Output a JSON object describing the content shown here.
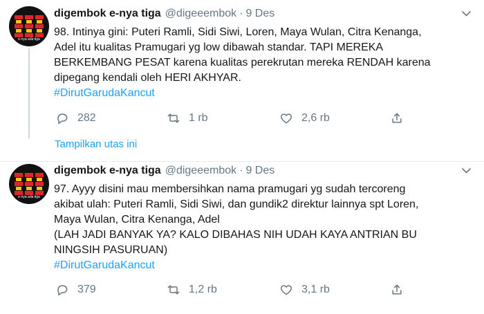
{
  "tweets": [
    {
      "display_name": "digembok e-nya tiga",
      "handle": "@digeeembok",
      "separator": "·",
      "date": "9 Des",
      "body_lines": [
        "98. Intinya gini: Puteri Ramli, Sidi Siwi, Loren, Maya Wulan, Citra Kenanga,",
        "Adel  itu kualitas Pramugari yg low dibawah standar. TAPI MEREKA",
        "BERKEMBANG PESAT karena kualitas perekrutan mereka RENDAH karena",
        "dipegang kendali oleh HERI AKHYAR."
      ],
      "hashtag": "#DirutGarudaKancut",
      "replies": "282",
      "retweets": "1 rb",
      "likes": "2,6 rb",
      "show_thread": "Tampilkan utas ini",
      "avatar_text": "e-nya ada tiga"
    },
    {
      "display_name": "digembok e-nya tiga",
      "handle": "@digeeembok",
      "separator": "·",
      "date": "9 Des",
      "body_lines": [
        "97. Ayyy disini mau membersihkan nama pramugari yg sudah tercoreng",
        "akibat ulah: Puteri Ramli, Sidi Siwi, dan gundik2 direktur lainnya spt Loren,",
        "Maya Wulan, Citra Kenanga, Adel",
        "(LAH JADI BANYAK YA? KALO DIBAHAS NIH UDAH KAYA ANTRIAN BU",
        "NINGSIH PASURUAN)"
      ],
      "hashtag": "#DirutGarudaKancut",
      "replies": "379",
      "retweets": "1,2 rb",
      "likes": "3,1 rb",
      "avatar_text": "e-nya ada tiga"
    }
  ],
  "colors": {
    "link": "#1da1f2",
    "muted": "#657786",
    "text": "#14171a",
    "divider": "#e6ecf0",
    "logo_red": "#e0262b",
    "logo_yellow": "#f2c21b"
  },
  "icons": {
    "reply": "reply-icon",
    "retweet": "retweet-icon",
    "like": "heart-icon",
    "share": "share-icon",
    "more": "chevron-down-icon"
  }
}
